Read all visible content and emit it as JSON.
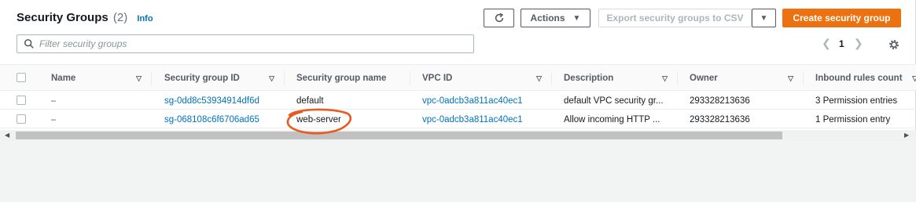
{
  "header": {
    "title": "Security Groups",
    "count": "(2)",
    "info": "Info"
  },
  "toolbar": {
    "actions_label": "Actions",
    "export_label": "Export security groups to CSV",
    "create_label": "Create security group"
  },
  "search": {
    "placeholder": "Filter security groups"
  },
  "pagination": {
    "current_page": "1"
  },
  "table": {
    "columns": [
      "Name",
      "Security group ID",
      "Security group name",
      "VPC ID",
      "Description",
      "Owner",
      "Inbound rules count"
    ],
    "rows": [
      {
        "name": "–",
        "sg_id": "sg-0dd8c53934914df6d",
        "sg_name": "default",
        "vpc_id": "vpc-0adcb3a811ac40ec1",
        "description": "default VPC security gr...",
        "owner": "293328213636",
        "inbound": "3 Permission entries"
      },
      {
        "name": "–",
        "sg_id": "sg-068108c6f6706ad65",
        "sg_name": "web-server",
        "vpc_id": "vpc-0adcb3a811ac40ec1",
        "description": "Allow incoming HTTP ...",
        "owner": "293328213636",
        "inbound": "1 Permission entry"
      }
    ]
  },
  "icons": {
    "refresh": "refresh-icon",
    "actions_caret": "caret-down-icon",
    "export_dropdown": "caret-down-icon",
    "search": "search-icon",
    "prev": "chevron-left-icon",
    "next": "chevron-right-icon",
    "settings": "gear-icon",
    "sort": "sort-caret-icon"
  },
  "colors": {
    "primary": "#ec7211",
    "link": "#0073bb",
    "annotation": "#ea5a1e"
  }
}
